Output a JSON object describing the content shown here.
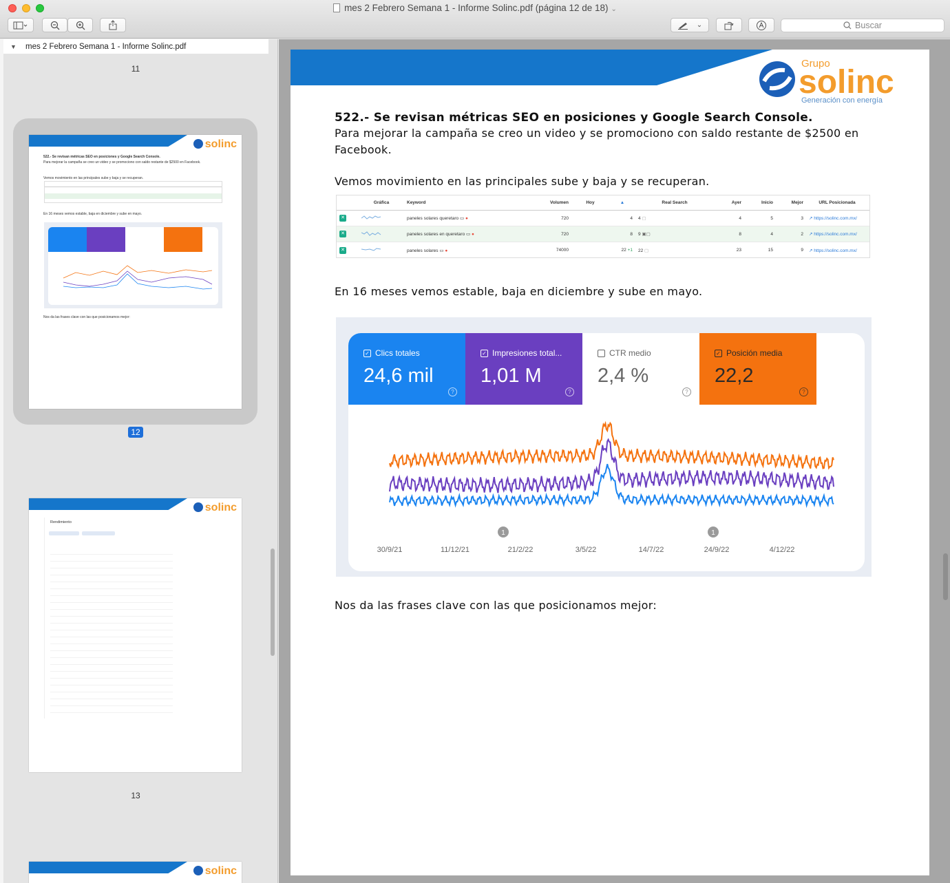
{
  "window": {
    "title": "mes 2 Febrero Semana 1 - Informe Solinc.pdf (página 12 de 18)",
    "search_placeholder": "Buscar"
  },
  "sidebar": {
    "file_name": "mes 2 Febrero Semana 1 - Informe Solinc.pdf",
    "pages": [
      {
        "number": "11"
      },
      {
        "number": "12",
        "selected": true
      },
      {
        "number": "13"
      }
    ],
    "thumb12_lines": [
      "522.- Se revisan métricas SEO en posiciones y Google Search Console.",
      "Para mejorar la campaña se creo un video y se promociono con saldo restante de $2500 en Facebook.",
      "Vemos movimiento en las principales sube y baja y se recuperan.",
      "En 16 meses vemos estable, baja en diciembre y sube en mayo.",
      "Nos da las frases clave con las que posicionamos mejor:"
    ],
    "thumb13_title": "Rendimiento"
  },
  "document": {
    "logo": {
      "grupo": "Grupo",
      "brand": "solinc",
      "tagline": "Generación con energía"
    },
    "heading": "522.- Se revisan métricas SEO en posiciones y Google Search Console.",
    "para1_line1": "Para mejorar la campaña se creo un video y se promociono con saldo restante de $2500 en",
    "para1_line2": "Facebook.",
    "para2": "Vemos movimiento en las principales sube y baja y se recuperan.",
    "para3": "En 16 meses vemos estable, baja en diciembre y sube en mayo.",
    "para4": "Nos da las frases clave con las que posicionamos mejor:"
  },
  "ranking_table": {
    "headers": [
      "Gráfica",
      "Keyword",
      "Volumen",
      "Hoy",
      "Real Search",
      "Ayer",
      "Inicio",
      "Mejor",
      "URL Posicionada"
    ],
    "rows": [
      {
        "keyword": "paneles solares queretaro",
        "volumen": "720",
        "hoy": "4",
        "real": "4",
        "ayer": "4",
        "inicio": "5",
        "mejor": "3",
        "url": "https://solinc.com.mx/"
      },
      {
        "keyword": "paneles solares en queretaro",
        "volumen": "720",
        "hoy": "8",
        "real": "9",
        "ayer": "8",
        "inicio": "4",
        "mejor": "2",
        "url": "https://solinc.com.mx/"
      },
      {
        "keyword": "paneles solares",
        "volumen": "74000",
        "hoy": "22",
        "hoy_delta": "+1",
        "real": "22",
        "ayer": "23",
        "inicio": "15",
        "mejor": "9",
        "url": "https://solinc.com.mx/"
      }
    ]
  },
  "search_console": {
    "metrics": [
      {
        "label": "Clics totales",
        "value": "24,6 mil",
        "checked": true,
        "color": "#1a84f0"
      },
      {
        "label": "Impresiones total...",
        "value": "1,01 M",
        "checked": true,
        "color": "#6a3fc0"
      },
      {
        "label": "CTR medio",
        "value": "2,4 %",
        "checked": false,
        "color": "#ffffff"
      },
      {
        "label": "Posición media",
        "value": "22,2",
        "checked": true,
        "color": "#f4720f"
      }
    ],
    "annotation_marker": "1"
  },
  "chart_data": {
    "type": "line",
    "x_ticks": [
      "30/9/21",
      "11/12/21",
      "21/2/22",
      "3/5/22",
      "14/7/22",
      "24/9/22",
      "4/12/22"
    ],
    "grid": false,
    "legend": "none",
    "series": [
      {
        "name": "Posición media",
        "color": "#f4720f"
      },
      {
        "name": "Impresiones total...",
        "color": "#6a3fc0"
      },
      {
        "name": "Clics totales",
        "color": "#1a84f0"
      }
    ],
    "annotations_at": [
      "11/12/21",
      "24/9/22"
    ]
  }
}
